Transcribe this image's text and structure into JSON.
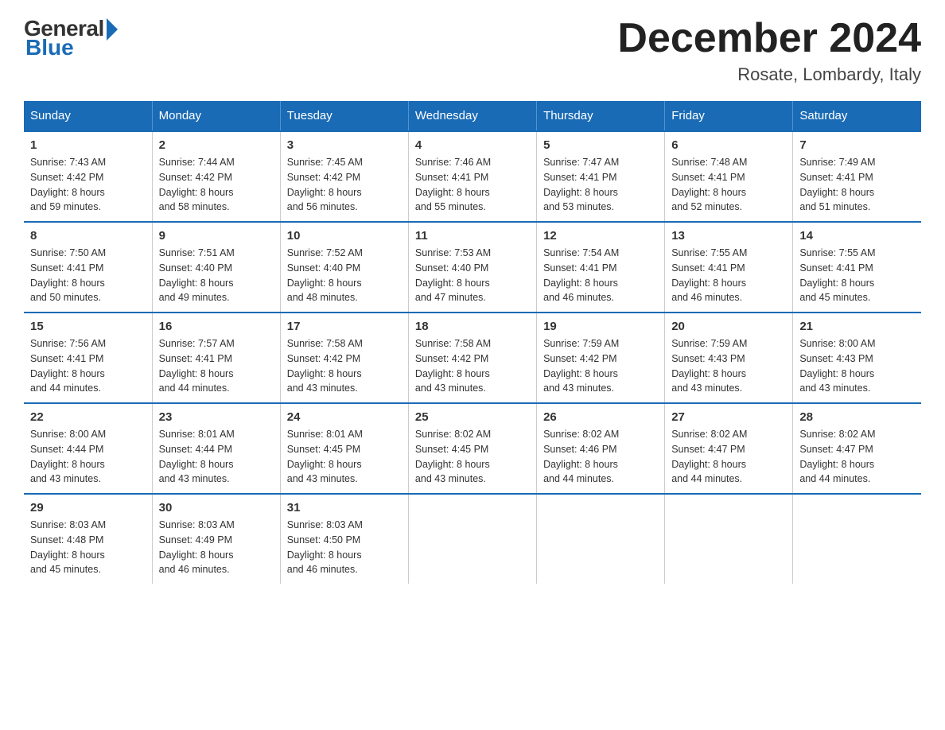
{
  "header": {
    "logo_general": "General",
    "logo_blue": "Blue",
    "month_title": "December 2024",
    "location": "Rosate, Lombardy, Italy"
  },
  "days_of_week": [
    "Sunday",
    "Monday",
    "Tuesday",
    "Wednesday",
    "Thursday",
    "Friday",
    "Saturday"
  ],
  "weeks": [
    [
      {
        "day": "1",
        "sunrise": "7:43 AM",
        "sunset": "4:42 PM",
        "daylight": "8 hours and 59 minutes."
      },
      {
        "day": "2",
        "sunrise": "7:44 AM",
        "sunset": "4:42 PM",
        "daylight": "8 hours and 58 minutes."
      },
      {
        "day": "3",
        "sunrise": "7:45 AM",
        "sunset": "4:42 PM",
        "daylight": "8 hours and 56 minutes."
      },
      {
        "day": "4",
        "sunrise": "7:46 AM",
        "sunset": "4:41 PM",
        "daylight": "8 hours and 55 minutes."
      },
      {
        "day": "5",
        "sunrise": "7:47 AM",
        "sunset": "4:41 PM",
        "daylight": "8 hours and 53 minutes."
      },
      {
        "day": "6",
        "sunrise": "7:48 AM",
        "sunset": "4:41 PM",
        "daylight": "8 hours and 52 minutes."
      },
      {
        "day": "7",
        "sunrise": "7:49 AM",
        "sunset": "4:41 PM",
        "daylight": "8 hours and 51 minutes."
      }
    ],
    [
      {
        "day": "8",
        "sunrise": "7:50 AM",
        "sunset": "4:41 PM",
        "daylight": "8 hours and 50 minutes."
      },
      {
        "day": "9",
        "sunrise": "7:51 AM",
        "sunset": "4:40 PM",
        "daylight": "8 hours and 49 minutes."
      },
      {
        "day": "10",
        "sunrise": "7:52 AM",
        "sunset": "4:40 PM",
        "daylight": "8 hours and 48 minutes."
      },
      {
        "day": "11",
        "sunrise": "7:53 AM",
        "sunset": "4:40 PM",
        "daylight": "8 hours and 47 minutes."
      },
      {
        "day": "12",
        "sunrise": "7:54 AM",
        "sunset": "4:41 PM",
        "daylight": "8 hours and 46 minutes."
      },
      {
        "day": "13",
        "sunrise": "7:55 AM",
        "sunset": "4:41 PM",
        "daylight": "8 hours and 46 minutes."
      },
      {
        "day": "14",
        "sunrise": "7:55 AM",
        "sunset": "4:41 PM",
        "daylight": "8 hours and 45 minutes."
      }
    ],
    [
      {
        "day": "15",
        "sunrise": "7:56 AM",
        "sunset": "4:41 PM",
        "daylight": "8 hours and 44 minutes."
      },
      {
        "day": "16",
        "sunrise": "7:57 AM",
        "sunset": "4:41 PM",
        "daylight": "8 hours and 44 minutes."
      },
      {
        "day": "17",
        "sunrise": "7:58 AM",
        "sunset": "4:42 PM",
        "daylight": "8 hours and 43 minutes."
      },
      {
        "day": "18",
        "sunrise": "7:58 AM",
        "sunset": "4:42 PM",
        "daylight": "8 hours and 43 minutes."
      },
      {
        "day": "19",
        "sunrise": "7:59 AM",
        "sunset": "4:42 PM",
        "daylight": "8 hours and 43 minutes."
      },
      {
        "day": "20",
        "sunrise": "7:59 AM",
        "sunset": "4:43 PM",
        "daylight": "8 hours and 43 minutes."
      },
      {
        "day": "21",
        "sunrise": "8:00 AM",
        "sunset": "4:43 PM",
        "daylight": "8 hours and 43 minutes."
      }
    ],
    [
      {
        "day": "22",
        "sunrise": "8:00 AM",
        "sunset": "4:44 PM",
        "daylight": "8 hours and 43 minutes."
      },
      {
        "day": "23",
        "sunrise": "8:01 AM",
        "sunset": "4:44 PM",
        "daylight": "8 hours and 43 minutes."
      },
      {
        "day": "24",
        "sunrise": "8:01 AM",
        "sunset": "4:45 PM",
        "daylight": "8 hours and 43 minutes."
      },
      {
        "day": "25",
        "sunrise": "8:02 AM",
        "sunset": "4:45 PM",
        "daylight": "8 hours and 43 minutes."
      },
      {
        "day": "26",
        "sunrise": "8:02 AM",
        "sunset": "4:46 PM",
        "daylight": "8 hours and 44 minutes."
      },
      {
        "day": "27",
        "sunrise": "8:02 AM",
        "sunset": "4:47 PM",
        "daylight": "8 hours and 44 minutes."
      },
      {
        "day": "28",
        "sunrise": "8:02 AM",
        "sunset": "4:47 PM",
        "daylight": "8 hours and 44 minutes."
      }
    ],
    [
      {
        "day": "29",
        "sunrise": "8:03 AM",
        "sunset": "4:48 PM",
        "daylight": "8 hours and 45 minutes."
      },
      {
        "day": "30",
        "sunrise": "8:03 AM",
        "sunset": "4:49 PM",
        "daylight": "8 hours and 46 minutes."
      },
      {
        "day": "31",
        "sunrise": "8:03 AM",
        "sunset": "4:50 PM",
        "daylight": "8 hours and 46 minutes."
      },
      null,
      null,
      null,
      null
    ]
  ],
  "labels": {
    "sunrise": "Sunrise:",
    "sunset": "Sunset:",
    "daylight": "Daylight:"
  }
}
